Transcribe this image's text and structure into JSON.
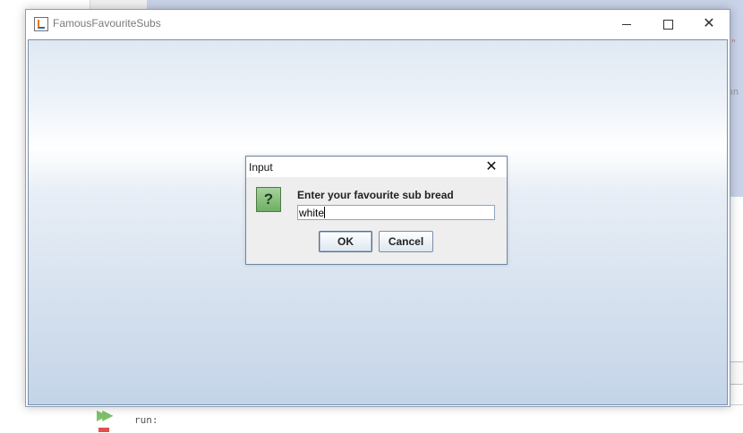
{
  "background_ide": {
    "run_text": "run:",
    "right_fragment": "on",
    "right_fragment2": "\""
  },
  "window": {
    "title": "FamousFavouriteSubs",
    "minimize": "—",
    "close": "✕"
  },
  "dialog": {
    "title": "Input",
    "close": "✕",
    "icon_glyph": "?",
    "prompt": "Enter your favourite sub bread",
    "input_value": "white",
    "ok_label": "OK",
    "cancel_label": "Cancel"
  }
}
